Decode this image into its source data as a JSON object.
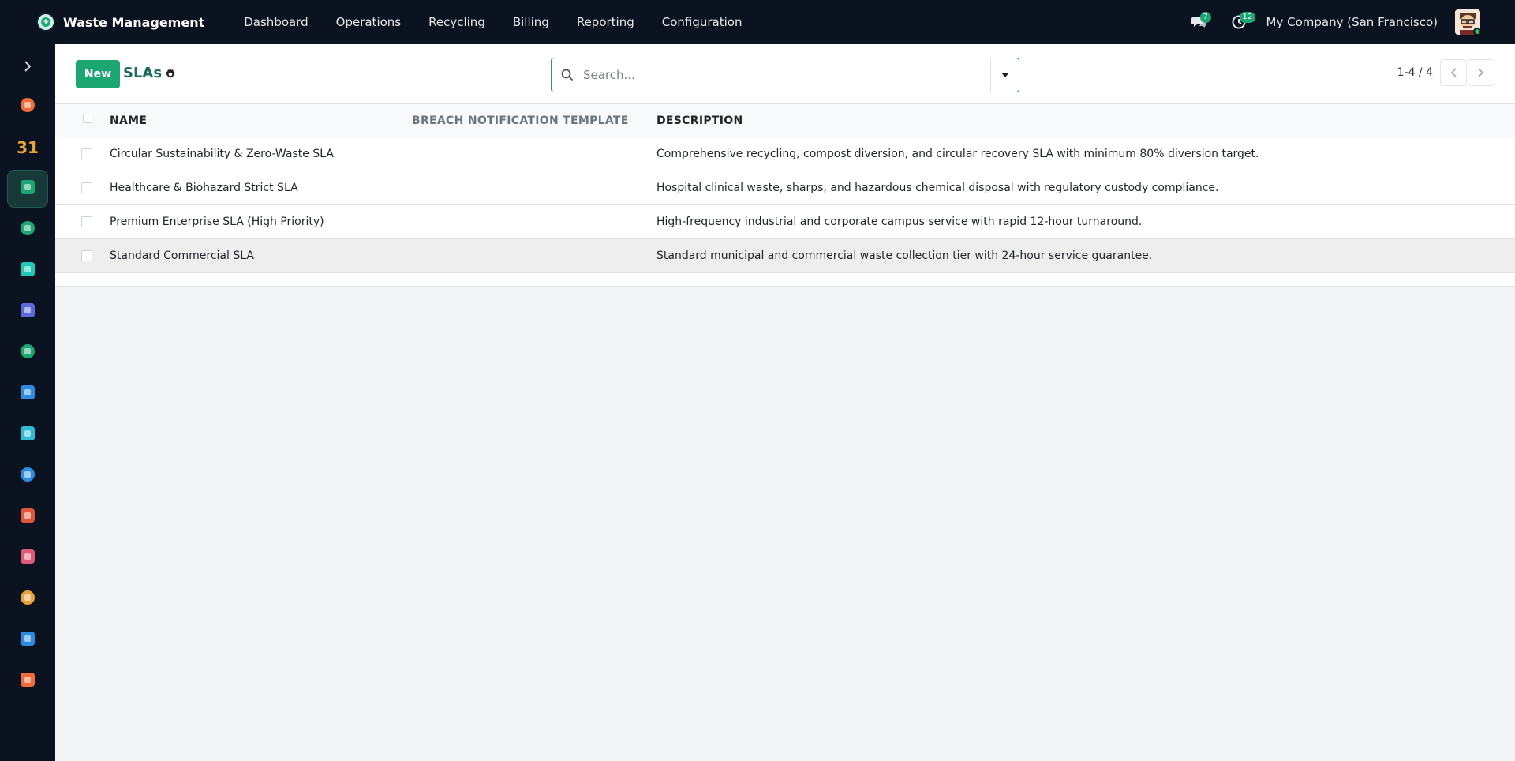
{
  "app": {
    "title": "Waste Management"
  },
  "menu": [
    "Dashboard",
    "Operations",
    "Recycling",
    "Billing",
    "Reporting",
    "Configuration"
  ],
  "systray": {
    "messages_count": "7",
    "activities_count": "12",
    "company": "My Company (San Francisco)"
  },
  "sidebar": {
    "apps": [
      {
        "name": "discuss-app-icon",
        "color": "#f26b3a"
      },
      {
        "name": "calendar-app-icon",
        "label": "31",
        "color": "#e8a23a"
      },
      {
        "name": "waste-management-app-icon",
        "color": "#1ba672",
        "active": true
      },
      {
        "name": "contacts-app-icon",
        "color": "#1ba672"
      },
      {
        "name": "crm-app-icon",
        "color": "#1ec8b5"
      },
      {
        "name": "dashboards-app-icon",
        "color": "#5a6ad8"
      },
      {
        "name": "recycling-app-icon",
        "color": "#1ba672"
      },
      {
        "name": "invoicing-app-icon",
        "color": "#2d8ce0"
      },
      {
        "name": "website-app-icon",
        "color": "#2dbbd8"
      },
      {
        "name": "project-app-icon",
        "color": "#2d8ce0"
      },
      {
        "name": "inventory-app-icon",
        "color": "#e0563a"
      },
      {
        "name": "fleet-app-icon",
        "color": "#e05a7a"
      },
      {
        "name": "sales-app-icon",
        "color": "#e8a23a"
      },
      {
        "name": "reporting-app-icon",
        "color": "#2d8ce0"
      },
      {
        "name": "apps-app-icon",
        "color": "#f26b3a"
      }
    ]
  },
  "control": {
    "new_label": "New",
    "title": "SLAs",
    "search_placeholder": "Search...",
    "pager": "1-4 / 4"
  },
  "list": {
    "headers": {
      "name": "NAME",
      "breach": "BREACH NOTIFICATION TEMPLATE",
      "description": "DESCRIPTION"
    },
    "rows": [
      {
        "name": "Circular Sustainability & Zero-Waste SLA",
        "breach": "",
        "description": "Comprehensive recycling, compost diversion, and circular recovery SLA with minimum 80% diversion target."
      },
      {
        "name": "Healthcare & Biohazard Strict SLA",
        "breach": "",
        "description": "Hospital clinical waste, sharps, and hazardous chemical disposal with regulatory custody compliance."
      },
      {
        "name": "Premium Enterprise SLA (High Priority)",
        "breach": "",
        "description": "High-frequency industrial and corporate campus service with rapid 12-hour turnaround."
      },
      {
        "name": "Standard Commercial SLA",
        "breach": "",
        "description": "Standard municipal and commercial waste collection tier with 24-hour service guarantee."
      }
    ]
  }
}
